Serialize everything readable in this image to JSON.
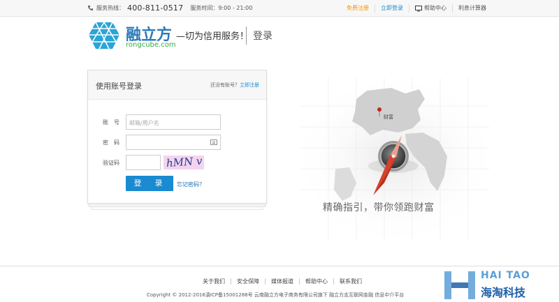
{
  "topbar": {
    "hotline_label": "服务热线：",
    "hotline_number": "400-811-0517",
    "hours": "服务时间：9:00 - 21:00",
    "free_register": "免费注册",
    "login_now": "立即登录",
    "help_center": "帮助中心",
    "calculator": "利息计算器"
  },
  "header": {
    "brand": "融立方",
    "slogan": "—切为信用服务！",
    "domain": "rongcube.com",
    "page_name": "登录"
  },
  "login": {
    "title": "使用账号登录",
    "no_account": "还没有账号？",
    "register_link": "立即注册",
    "account_label": "账　号",
    "account_placeholder": "邮箱/用户名",
    "password_label": "密　码",
    "captcha_label": "验证码",
    "captcha_text": "hMN v",
    "login_button": "登　录",
    "forgot": "忘记密码？"
  },
  "illustration": {
    "city": "财富",
    "caption": "精确指引，带你领跑财富"
  },
  "footer": {
    "links": [
      "关于我们",
      "安全保障",
      "媒体报道",
      "帮助中心",
      "联系我们"
    ],
    "copyright": "Copyright © 2012-2016滇ICP备15001288号 云南融立方电子商务有限公司旗下 融立方志互联网金融 信息中介平台"
  },
  "watermark": {
    "top": "HAI TAO",
    "bottom": "海淘科技"
  },
  "colors": {
    "accent": "#1a8ad1",
    "orange": "#f39800",
    "logo_blue": "#2a7ab8"
  }
}
